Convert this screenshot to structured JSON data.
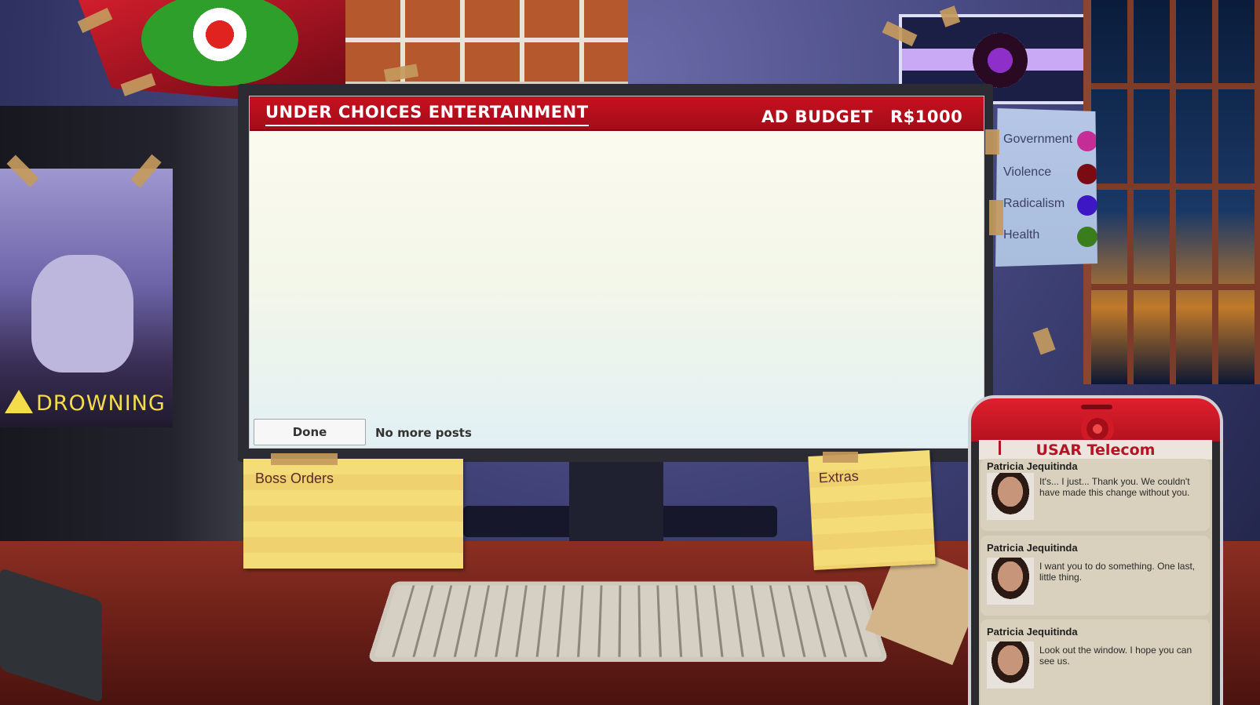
{
  "ad_window": {
    "company": "UNDER CHOICES ENTERTAINMENT",
    "budget_label": "AD BUDGET",
    "budget_value": "R$1000",
    "done_label": "Done",
    "status_text": "No more posts"
  },
  "legend": {
    "items": [
      {
        "label": "Government",
        "color": "#c42c96"
      },
      {
        "label": "Violence",
        "color": "#7b0b12"
      },
      {
        "label": "Radicalism",
        "color": "#3d17c4"
      },
      {
        "label": "Health",
        "color": "#3a7d1d"
      }
    ]
  },
  "poster": {
    "label": "DROWNING"
  },
  "notes": {
    "boss_orders": "Boss Orders",
    "extras": "Extras"
  },
  "phone": {
    "title": "USAR Telecom",
    "messages": [
      {
        "sender": "Patricia Jequitinda",
        "text": "It's... I just... Thank you. We couldn't have made this change without you."
      },
      {
        "sender": "Patricia Jequitinda",
        "text": "I want you to do something. One last, little thing."
      },
      {
        "sender": "Patricia Jequitinda",
        "text": "Look out the window. I hope you can see us."
      }
    ]
  }
}
